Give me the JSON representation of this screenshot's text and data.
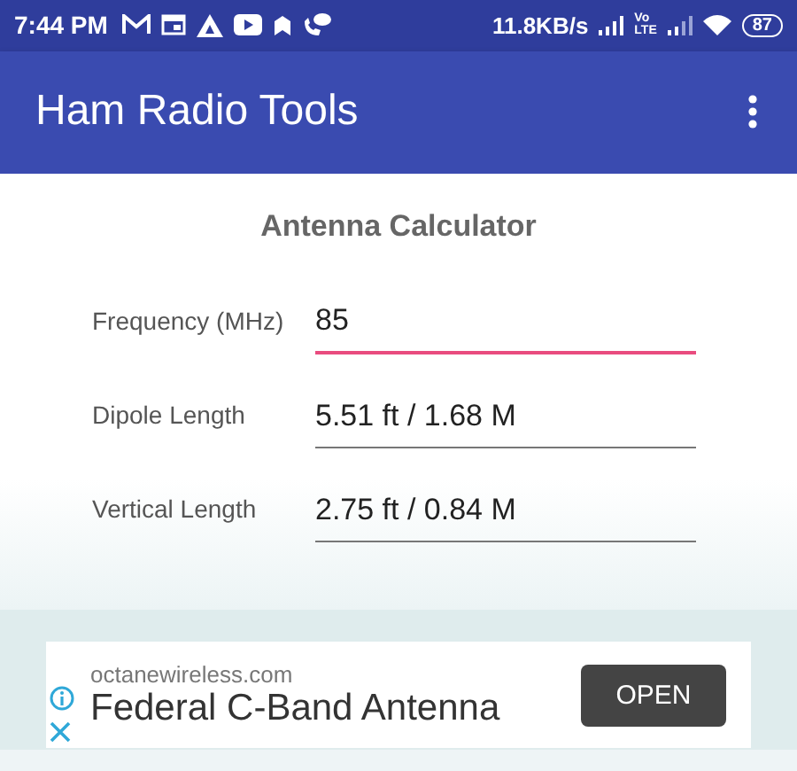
{
  "status_bar": {
    "time": "7:44 PM",
    "speed": "11.8KB/s",
    "network_type": [
      "Vo",
      "LTE"
    ],
    "battery": "87"
  },
  "app_bar": {
    "title": "Ham Radio Tools"
  },
  "calculator": {
    "title": "Antenna Calculator",
    "fields": [
      {
        "label": "Frequency (MHz)",
        "value": "85",
        "focused": true
      },
      {
        "label": "Dipole Length",
        "value": "5.51 ft / 1.68 M",
        "focused": false
      },
      {
        "label": "Vertical Length",
        "value": "2.75 ft / 0.84 M",
        "focused": false
      }
    ]
  },
  "ad": {
    "domain": "octanewireless.com",
    "headline": "Federal C-Band Antenna",
    "button": "OPEN"
  }
}
